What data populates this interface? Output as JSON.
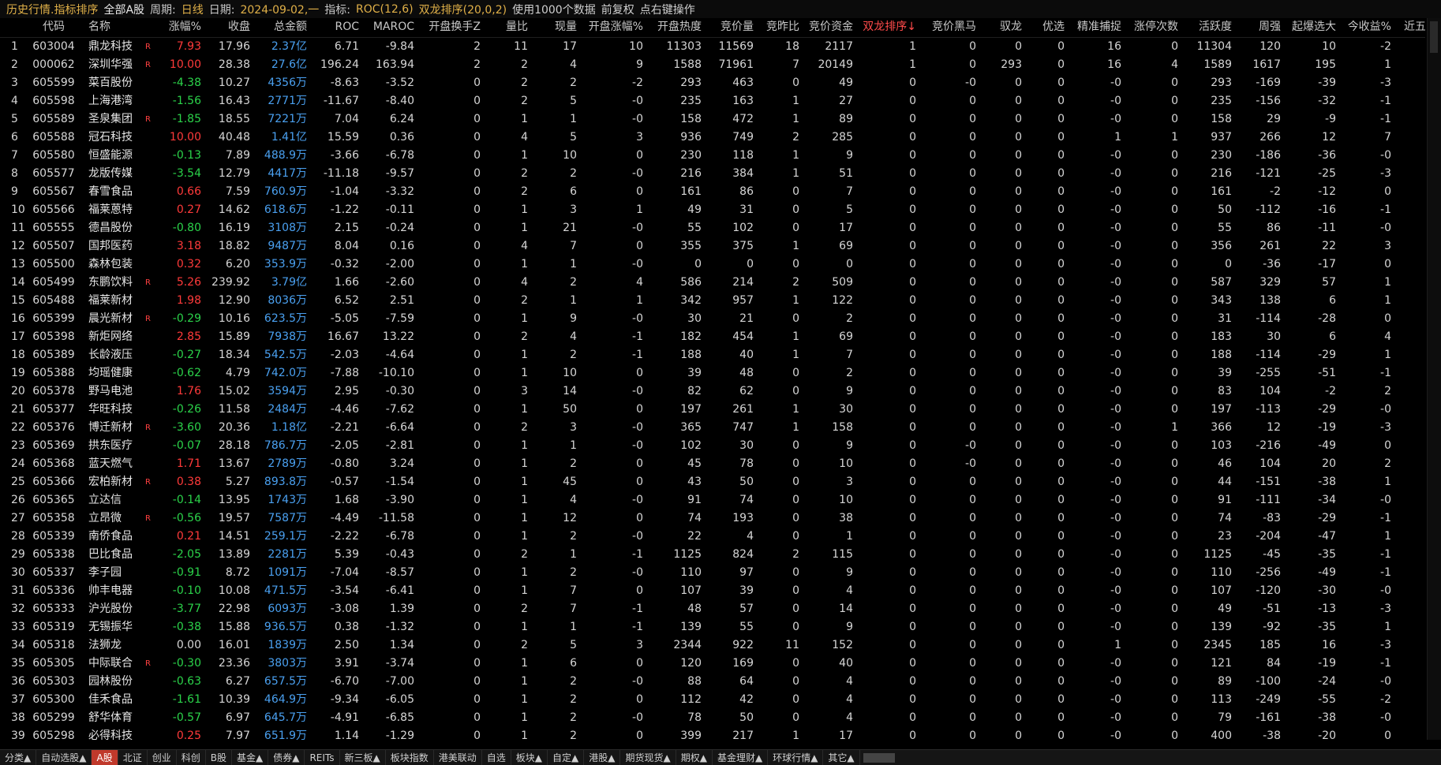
{
  "topbar": {
    "title": "历史行情.指标排序",
    "market": "全部A股",
    "period_label": "周期:",
    "period_value": "日线",
    "date_label": "日期:",
    "date_value": "2024-09-02,一",
    "indicator_label": "指标:",
    "indicator_value": "ROC(12,6)",
    "sort_value": "双龙排序(20,0,2)",
    "hint1": "使用1000个数据",
    "hint2": "前复权",
    "hint3": "点右键操作"
  },
  "columns": [
    "",
    "代码",
    "名称",
    "",
    "涨幅%",
    "收盘",
    "总金额",
    "ROC",
    "MAROC",
    "开盘换手Z",
    "量比",
    "现量",
    "开盘涨幅%",
    "开盘热度",
    "竞价量",
    "竞昨比",
    "竞价资金",
    "双龙排序↓",
    "竞价黑马",
    "驭龙",
    "优选",
    "精准捕捉",
    "涨停次数",
    "活跃度",
    "周强",
    "起爆选大",
    "今收益%",
    "近五日"
  ],
  "rows": [
    [
      "1",
      "603004",
      "鼎龙科技",
      "R",
      "7.93",
      "17.96",
      "2.37亿",
      "6.71",
      "-9.84",
      "2",
      "11",
      "17",
      "10",
      "11303",
      "11569",
      "18",
      "2117",
      "1",
      "0",
      "0",
      "0",
      "16",
      "0",
      "11304",
      "120",
      "10",
      "-2"
    ],
    [
      "2",
      "000062",
      "深圳华强",
      "R",
      "10.00",
      "28.38",
      "27.6亿",
      "196.24",
      "163.94",
      "2",
      "2",
      "4",
      "9",
      "1588",
      "71961",
      "7",
      "20149",
      "1",
      "0",
      "293",
      "0",
      "16",
      "4",
      "1589",
      "1617",
      "195",
      "1"
    ],
    [
      "3",
      "605599",
      "菜百股份",
      "",
      "-4.38",
      "10.27",
      "4356万",
      "-8.63",
      "-3.52",
      "0",
      "2",
      "2",
      "-2",
      "293",
      "463",
      "0",
      "49",
      "0",
      "-0",
      "0",
      "0",
      "-0",
      "0",
      "293",
      "-169",
      "-39",
      "-3"
    ],
    [
      "4",
      "605598",
      "上海港湾",
      "",
      "-1.56",
      "16.43",
      "2771万",
      "-11.67",
      "-8.40",
      "0",
      "2",
      "5",
      "-0",
      "235",
      "163",
      "1",
      "27",
      "0",
      "0",
      "0",
      "0",
      "-0",
      "0",
      "235",
      "-156",
      "-32",
      "-1"
    ],
    [
      "5",
      "605589",
      "圣泉集团",
      "R",
      "-1.85",
      "18.55",
      "7221万",
      "7.04",
      "6.24",
      "0",
      "1",
      "1",
      "-0",
      "158",
      "472",
      "1",
      "89",
      "0",
      "0",
      "0",
      "0",
      "-0",
      "0",
      "158",
      "29",
      "-9",
      "-1"
    ],
    [
      "6",
      "605588",
      "冠石科技",
      "",
      "10.00",
      "40.48",
      "1.41亿",
      "15.59",
      "0.36",
      "0",
      "4",
      "5",
      "3",
      "936",
      "749",
      "2",
      "285",
      "0",
      "0",
      "0",
      "0",
      "1",
      "1",
      "937",
      "266",
      "12",
      "7"
    ],
    [
      "7",
      "605580",
      "恒盛能源",
      "",
      "-0.13",
      "7.89",
      "488.9万",
      "-3.66",
      "-6.78",
      "0",
      "1",
      "10",
      "0",
      "230",
      "118",
      "1",
      "9",
      "0",
      "0",
      "0",
      "0",
      "-0",
      "0",
      "230",
      "-186",
      "-36",
      "-0"
    ],
    [
      "8",
      "605577",
      "龙版传媒",
      "",
      "-3.54",
      "12.79",
      "4417万",
      "-11.18",
      "-9.57",
      "0",
      "2",
      "2",
      "-0",
      "216",
      "384",
      "1",
      "51",
      "0",
      "0",
      "0",
      "0",
      "-0",
      "0",
      "216",
      "-121",
      "-25",
      "-3"
    ],
    [
      "9",
      "605567",
      "春雪食品",
      "",
      "0.66",
      "7.59",
      "760.9万",
      "-1.04",
      "-3.32",
      "0",
      "2",
      "6",
      "0",
      "161",
      "86",
      "0",
      "7",
      "0",
      "0",
      "0",
      "0",
      "-0",
      "0",
      "161",
      "-2",
      "-12",
      "0"
    ],
    [
      "10",
      "605566",
      "福莱蒽特",
      "",
      "0.27",
      "14.62",
      "618.6万",
      "-1.22",
      "-0.11",
      "0",
      "1",
      "3",
      "1",
      "49",
      "31",
      "0",
      "5",
      "0",
      "0",
      "0",
      "0",
      "-0",
      "0",
      "50",
      "-112",
      "-16",
      "-1"
    ],
    [
      "11",
      "605555",
      "德昌股份",
      "",
      "-0.80",
      "16.19",
      "3108万",
      "2.15",
      "-0.24",
      "0",
      "1",
      "21",
      "-0",
      "55",
      "102",
      "0",
      "17",
      "0",
      "0",
      "0",
      "0",
      "-0",
      "0",
      "55",
      "86",
      "-11",
      "-0"
    ],
    [
      "12",
      "605507",
      "国邦医药",
      "",
      "3.18",
      "18.82",
      "9487万",
      "8.04",
      "0.16",
      "0",
      "4",
      "7",
      "0",
      "355",
      "375",
      "1",
      "69",
      "0",
      "0",
      "0",
      "0",
      "-0",
      "0",
      "356",
      "261",
      "22",
      "3"
    ],
    [
      "13",
      "605500",
      "森林包装",
      "",
      "0.32",
      "6.20",
      "353.9万",
      "-0.32",
      "-2.00",
      "0",
      "1",
      "1",
      "-0",
      "0",
      "0",
      "0",
      "0",
      "0",
      "0",
      "0",
      "0",
      "-0",
      "0",
      "0",
      "-36",
      "-17",
      "0"
    ],
    [
      "14",
      "605499",
      "东鹏饮料",
      "R",
      "5.26",
      "239.92",
      "3.79亿",
      "1.66",
      "-2.60",
      "0",
      "4",
      "2",
      "4",
      "586",
      "214",
      "2",
      "509",
      "0",
      "0",
      "0",
      "0",
      "-0",
      "0",
      "587",
      "329",
      "57",
      "1"
    ],
    [
      "15",
      "605488",
      "福莱新材",
      "",
      "1.98",
      "12.90",
      "8036万",
      "6.52",
      "2.51",
      "0",
      "2",
      "1",
      "1",
      "342",
      "957",
      "1",
      "122",
      "0",
      "0",
      "0",
      "0",
      "-0",
      "0",
      "343",
      "138",
      "6",
      "1"
    ],
    [
      "16",
      "605399",
      "晨光新材",
      "R",
      "-0.29",
      "10.16",
      "623.5万",
      "-5.05",
      "-7.59",
      "0",
      "1",
      "9",
      "-0",
      "30",
      "21",
      "0",
      "2",
      "0",
      "0",
      "0",
      "0",
      "-0",
      "0",
      "31",
      "-114",
      "-28",
      "0"
    ],
    [
      "17",
      "605398",
      "新炬网络",
      "",
      "2.85",
      "15.89",
      "7938万",
      "16.67",
      "13.22",
      "0",
      "2",
      "4",
      "-1",
      "182",
      "454",
      "1",
      "69",
      "0",
      "0",
      "0",
      "0",
      "-0",
      "0",
      "183",
      "30",
      "6",
      "4"
    ],
    [
      "18",
      "605389",
      "长龄液压",
      "",
      "-0.27",
      "18.34",
      "542.5万",
      "-2.03",
      "-4.64",
      "0",
      "1",
      "2",
      "-1",
      "188",
      "40",
      "1",
      "7",
      "0",
      "0",
      "0",
      "0",
      "-0",
      "0",
      "188",
      "-114",
      "-29",
      "1"
    ],
    [
      "19",
      "605388",
      "均瑶健康",
      "",
      "-0.62",
      "4.79",
      "742.0万",
      "-7.88",
      "-10.10",
      "0",
      "1",
      "10",
      "0",
      "39",
      "48",
      "0",
      "2",
      "0",
      "0",
      "0",
      "0",
      "-0",
      "0",
      "39",
      "-255",
      "-51",
      "-1"
    ],
    [
      "20",
      "605378",
      "野马电池",
      "",
      "1.76",
      "15.02",
      "3594万",
      "2.95",
      "-0.30",
      "0",
      "3",
      "14",
      "-0",
      "82",
      "62",
      "0",
      "9",
      "0",
      "0",
      "0",
      "0",
      "-0",
      "0",
      "83",
      "104",
      "-2",
      "2"
    ],
    [
      "21",
      "605377",
      "华旺科技",
      "",
      "-0.26",
      "11.58",
      "2484万",
      "-4.46",
      "-7.62",
      "0",
      "1",
      "50",
      "0",
      "197",
      "261",
      "1",
      "30",
      "0",
      "0",
      "0",
      "0",
      "-0",
      "0",
      "197",
      "-113",
      "-29",
      "-0"
    ],
    [
      "22",
      "605376",
      "博迁新材",
      "R",
      "-3.60",
      "20.36",
      "1.18亿",
      "-2.21",
      "-6.64",
      "0",
      "2",
      "3",
      "-0",
      "365",
      "747",
      "1",
      "158",
      "0",
      "0",
      "0",
      "0",
      "-0",
      "1",
      "366",
      "12",
      "-19",
      "-3"
    ],
    [
      "23",
      "605369",
      "拱东医疗",
      "",
      "-0.07",
      "28.18",
      "786.7万",
      "-2.05",
      "-2.81",
      "0",
      "1",
      "1",
      "-0",
      "102",
      "30",
      "0",
      "9",
      "0",
      "-0",
      "0",
      "0",
      "-0",
      "0",
      "103",
      "-216",
      "-49",
      "0"
    ],
    [
      "24",
      "605368",
      "蓝天燃气",
      "",
      "1.71",
      "13.67",
      "2789万",
      "-0.80",
      "3.24",
      "0",
      "1",
      "2",
      "0",
      "45",
      "78",
      "0",
      "10",
      "0",
      "-0",
      "0",
      "0",
      "-0",
      "0",
      "46",
      "104",
      "20",
      "2"
    ],
    [
      "25",
      "605366",
      "宏柏新材",
      "R",
      "0.38",
      "5.27",
      "893.8万",
      "-0.57",
      "-1.54",
      "0",
      "1",
      "45",
      "0",
      "43",
      "50",
      "0",
      "3",
      "0",
      "0",
      "0",
      "0",
      "-0",
      "0",
      "44",
      "-151",
      "-38",
      "1"
    ],
    [
      "26",
      "605365",
      "立达信",
      "",
      "-0.14",
      "13.95",
      "1743万",
      "1.68",
      "-3.90",
      "0",
      "1",
      "4",
      "-0",
      "91",
      "74",
      "0",
      "10",
      "0",
      "0",
      "0",
      "0",
      "-0",
      "0",
      "91",
      "-111",
      "-34",
      "-0"
    ],
    [
      "27",
      "605358",
      "立昂微",
      "R",
      "-0.56",
      "19.57",
      "7587万",
      "-4.49",
      "-11.58",
      "0",
      "1",
      "12",
      "0",
      "74",
      "193",
      "0",
      "38",
      "0",
      "0",
      "0",
      "0",
      "-0",
      "0",
      "74",
      "-83",
      "-29",
      "-1"
    ],
    [
      "28",
      "605339",
      "南侨食品",
      "",
      "0.21",
      "14.51",
      "259.1万",
      "-2.22",
      "-6.78",
      "0",
      "1",
      "2",
      "-0",
      "22",
      "4",
      "0",
      "1",
      "0",
      "0",
      "0",
      "0",
      "-0",
      "0",
      "23",
      "-204",
      "-47",
      "1"
    ],
    [
      "29",
      "605338",
      "巴比食品",
      "",
      "-2.05",
      "13.89",
      "2281万",
      "5.39",
      "-0.43",
      "0",
      "2",
      "1",
      "-1",
      "1125",
      "824",
      "2",
      "115",
      "0",
      "0",
      "0",
      "0",
      "-0",
      "0",
      "1125",
      "-45",
      "-35",
      "-1"
    ],
    [
      "30",
      "605337",
      "李子园",
      "",
      "-0.91",
      "8.72",
      "1091万",
      "-7.04",
      "-8.57",
      "0",
      "1",
      "2",
      "-0",
      "110",
      "97",
      "0",
      "9",
      "0",
      "0",
      "0",
      "0",
      "-0",
      "0",
      "110",
      "-256",
      "-49",
      "-1"
    ],
    [
      "31",
      "605336",
      "帅丰电器",
      "",
      "-0.10",
      "10.08",
      "471.5万",
      "-3.54",
      "-6.41",
      "0",
      "1",
      "7",
      "0",
      "107",
      "39",
      "0",
      "4",
      "0",
      "0",
      "0",
      "0",
      "-0",
      "0",
      "107",
      "-120",
      "-30",
      "-0"
    ],
    [
      "32",
      "605333",
      "沪光股份",
      "",
      "-3.77",
      "22.98",
      "6093万",
      "-3.08",
      "1.39",
      "0",
      "2",
      "7",
      "-1",
      "48",
      "57",
      "0",
      "14",
      "0",
      "0",
      "0",
      "0",
      "-0",
      "0",
      "49",
      "-51",
      "-13",
      "-3"
    ],
    [
      "33",
      "605319",
      "无锡振华",
      "",
      "-0.38",
      "15.88",
      "936.5万",
      "0.38",
      "-1.32",
      "0",
      "1",
      "1",
      "-1",
      "139",
      "55",
      "0",
      "9",
      "0",
      "0",
      "0",
      "0",
      "-0",
      "0",
      "139",
      "-92",
      "-35",
      "1"
    ],
    [
      "34",
      "605318",
      "法狮龙",
      "",
      "0.00",
      "16.01",
      "1839万",
      "2.50",
      "1.34",
      "0",
      "2",
      "5",
      "3",
      "2344",
      "922",
      "11",
      "152",
      "0",
      "0",
      "0",
      "0",
      "1",
      "0",
      "2345",
      "185",
      "16",
      "-3"
    ],
    [
      "35",
      "605305",
      "中际联合",
      "R",
      "-0.30",
      "23.36",
      "3803万",
      "3.91",
      "-3.74",
      "0",
      "1",
      "6",
      "0",
      "120",
      "169",
      "0",
      "40",
      "0",
      "0",
      "0",
      "0",
      "-0",
      "0",
      "121",
      "84",
      "-19",
      "-1"
    ],
    [
      "36",
      "605303",
      "园林股份",
      "",
      "-0.63",
      "6.27",
      "657.5万",
      "-6.70",
      "-7.00",
      "0",
      "1",
      "2",
      "-0",
      "88",
      "64",
      "0",
      "4",
      "0",
      "0",
      "0",
      "0",
      "-0",
      "0",
      "89",
      "-100",
      "-24",
      "-0"
    ],
    [
      "37",
      "605300",
      "佳禾食品",
      "",
      "-1.61",
      "10.39",
      "464.9万",
      "-9.34",
      "-6.05",
      "0",
      "1",
      "2",
      "0",
      "112",
      "42",
      "0",
      "4",
      "0",
      "0",
      "0",
      "0",
      "-0",
      "0",
      "113",
      "-249",
      "-55",
      "-2"
    ],
    [
      "38",
      "605299",
      "舒华体育",
      "",
      "-0.57",
      "6.97",
      "645.7万",
      "-4.91",
      "-6.85",
      "0",
      "1",
      "2",
      "-0",
      "78",
      "50",
      "0",
      "4",
      "0",
      "0",
      "0",
      "0",
      "-0",
      "0",
      "79",
      "-161",
      "-38",
      "-0"
    ],
    [
      "39",
      "605298",
      "必得科技",
      "",
      "0.25",
      "7.97",
      "651.9万",
      "1.14",
      "-1.29",
      "0",
      "1",
      "2",
      "0",
      "399",
      "217",
      "1",
      "17",
      "0",
      "0",
      "0",
      "0",
      "-0",
      "0",
      "400",
      "-38",
      "-20",
      "0"
    ]
  ],
  "bottom_tabs": [
    "分类▲",
    "自动选股▲",
    "A股",
    "北证",
    "创业",
    "科创",
    "B股",
    "基金▲",
    "债券▲",
    "REITs",
    "新三板▲",
    "板块指数",
    "港美联动",
    "自选",
    "板块▲",
    "自定▲",
    "港股▲",
    "期货现货▲",
    "期权▲",
    "基金理财▲",
    "环球行情▲",
    "其它▲"
  ],
  "active_tab": "A股",
  "colors": {
    "up": "#ff3a3a",
    "down": "#2bd34a",
    "amount": "#4aa0f0",
    "accent": "#e0b048",
    "active_tab": "#c0392b"
  }
}
